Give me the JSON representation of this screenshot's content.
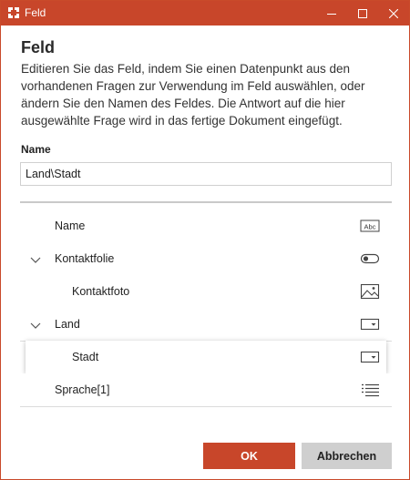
{
  "window": {
    "title": "Feld",
    "accent_color": "#c8462a",
    "icon": "app-logo-icon",
    "controls": [
      "minimize-icon",
      "maximize-icon",
      "close-icon"
    ]
  },
  "dialog": {
    "heading": "Feld",
    "description": "Editieren Sie das Feld, indem Sie einen Datenpunkt aus den vorhandenen Fragen zur Verwendung im Feld auswählen, oder ändern Sie den Namen des Feldes. Die Antwort auf die hier ausgewählte Frage wird in das fertige Dokument eingefügt.",
    "name_label": "Name",
    "name_value": "Land\\Stadt"
  },
  "tree": [
    {
      "label": "Name",
      "expandable": false,
      "icon": "text-field-icon"
    },
    {
      "label": "Kontaktfolie",
      "expandable": true,
      "icon": "toggle-icon"
    },
    {
      "label": "Kontaktfoto",
      "expandable": false,
      "icon": "image-icon"
    },
    {
      "label": "Land",
      "expandable": true,
      "icon": "dropdown-icon"
    },
    {
      "label": "Stadt",
      "expandable": false,
      "icon": "dropdown-icon",
      "selected": true
    },
    {
      "label": "Sprache[1]",
      "expandable": false,
      "icon": "list-icon"
    }
  ],
  "buttons": {
    "ok": "OK",
    "cancel": "Abbrechen"
  }
}
